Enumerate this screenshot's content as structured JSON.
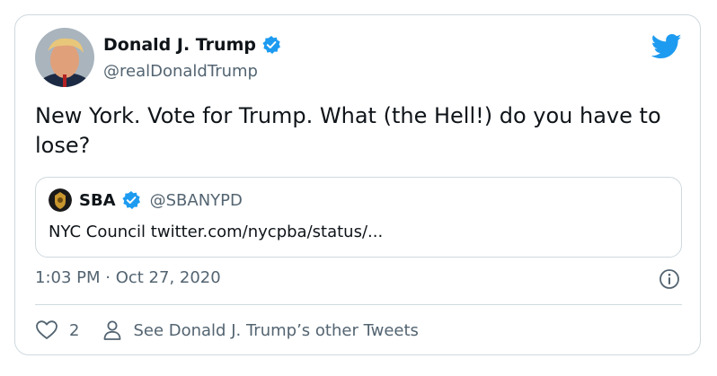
{
  "author": {
    "name": "Donald J. Trump",
    "handle": "@realDonaldTrump",
    "avatar_icon": "avatar-photo",
    "verified_icon": "verified-badge-icon"
  },
  "tweet": {
    "text": "New York. Vote for Trump. What (the Hell!) do you have to lose?",
    "timestamp": "1:03 PM · Oct 27, 2020"
  },
  "quote": {
    "name": "SBA",
    "handle": "@SBANYPD",
    "text": "NYC Council twitter.com/nycpba/status/..."
  },
  "actions": {
    "like_count": "2",
    "other_tweets_label": "See Donald J. Trump’s other Tweets"
  },
  "colors": {
    "accent": "#1d9bf0",
    "text": "#0f1419",
    "secondary": "#536471",
    "border": "#cfd9de"
  }
}
